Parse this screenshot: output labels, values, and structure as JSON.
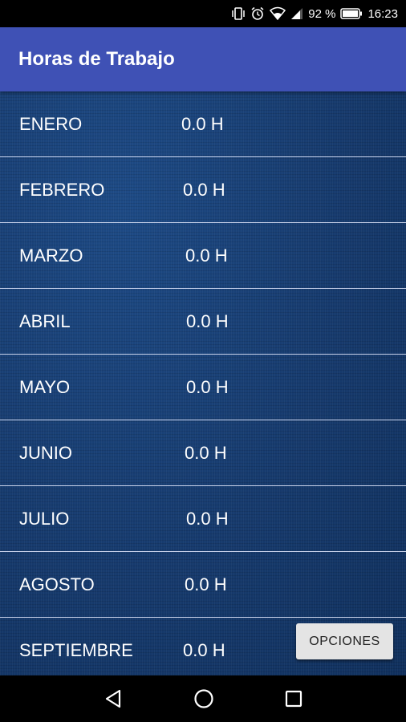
{
  "status_bar": {
    "battery_percent": "92 %",
    "time": "16:23",
    "icons": [
      "vibrate-icon",
      "alarm-icon",
      "wifi-icon",
      "signal-icon",
      "battery-icon"
    ]
  },
  "app_bar": {
    "title": "Horas de Trabajo"
  },
  "months": [
    {
      "name": "ENERO",
      "hours": "0.0 H"
    },
    {
      "name": "FEBRERO",
      "hours": "0.0 H"
    },
    {
      "name": "MARZO",
      "hours": "0.0 H"
    },
    {
      "name": "ABRIL",
      "hours": "0.0 H"
    },
    {
      "name": "MAYO",
      "hours": "0.0 H"
    },
    {
      "name": "JUNIO",
      "hours": "0.0 H"
    },
    {
      "name": "JULIO",
      "hours": "0.0 H"
    },
    {
      "name": "AGOSTO",
      "hours": "0.0 H"
    },
    {
      "name": "SEPTIEMBRE",
      "hours": "0.0 H"
    }
  ],
  "options_button": {
    "label": "OPCIONES"
  },
  "nav_bar": {
    "buttons": [
      "back-icon",
      "home-icon",
      "recents-icon"
    ]
  },
  "colors": {
    "app_bar": "#3f51b5",
    "content_background": "#173a6e",
    "divider": "#e6ebff"
  }
}
